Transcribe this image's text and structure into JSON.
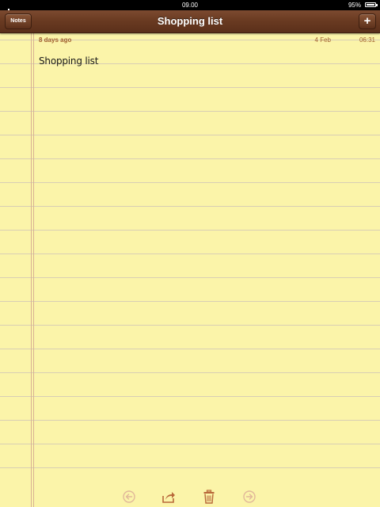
{
  "status_bar": {
    "time": "09.00",
    "battery": "95%"
  },
  "nav": {
    "back_label": "Notes",
    "title": "Shopping list",
    "add_label": "+"
  },
  "note": {
    "age": "8 days ago",
    "date": "4 Feb",
    "time": "06:31",
    "body": "Shopping list"
  },
  "toolbar": {
    "icons": [
      "previous-note-icon",
      "share-icon",
      "trash-icon",
      "next-note-icon"
    ]
  },
  "colors": {
    "paper": "#fbf4a9",
    "leather": "#6a3b22",
    "meta_text": "#a0602f",
    "toolbar_icon": "#b8683a"
  }
}
